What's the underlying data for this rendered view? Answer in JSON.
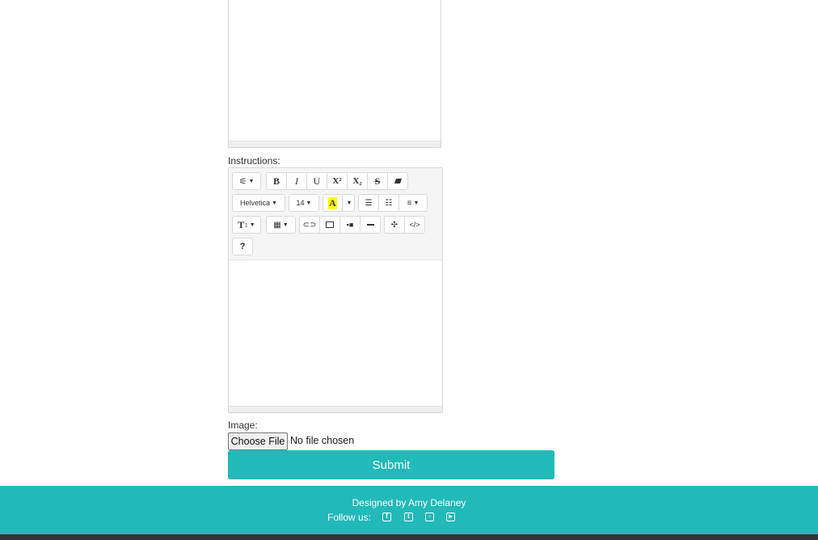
{
  "instructions_label": "Instructions:",
  "image_label": "Image:",
  "toolbar": {
    "font_name": "Helvetica",
    "font_size": "14",
    "bold": "B",
    "italic": "I",
    "underline": "U",
    "superscript": "X²",
    "subscript": "X₂",
    "strikethrough": "S",
    "color_letter": "A",
    "style": "T",
    "help": "?",
    "code": "</>",
    "hr": "—"
  },
  "file": {
    "button": "Choose File",
    "status": "No file chosen"
  },
  "submit": "Submit",
  "footer": {
    "credit": "Designed by Amy Delaney",
    "follow": "Follow us:"
  },
  "colors": {
    "accent": "#22b9b9",
    "highlight": "#ffff00"
  }
}
